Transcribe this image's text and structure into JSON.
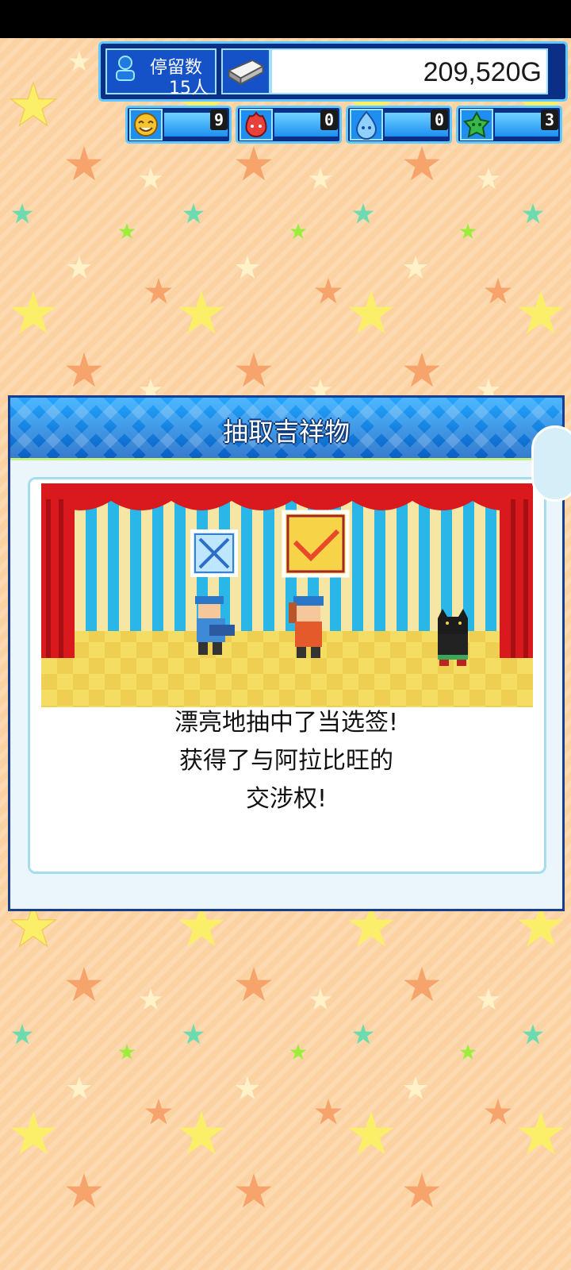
{
  "hud": {
    "stay_label": "停留数",
    "stay_value": "15人",
    "money": "209,520G",
    "resources": [
      {
        "icon": "yellow-smile-icon",
        "value": "9",
        "color": "#f6c431"
      },
      {
        "icon": "red-flame-icon",
        "value": "0",
        "color": "#e8413c"
      },
      {
        "icon": "blue-drop-icon",
        "value": "0",
        "color": "#49a7ec"
      },
      {
        "icon": "green-leaf-icon",
        "value": "3",
        "color": "#38b84a"
      }
    ]
  },
  "dialog": {
    "title": "抽取吉祥物",
    "lines": [
      "漂亮地抽中了当选签!",
      "获得了与阿拉比旺的",
      "交涉权!"
    ]
  },
  "colors": {
    "background": "#fbd3a3",
    "curtain": "#d9191d",
    "header_blue": "#0a7ee8",
    "check_red": "#e64a2a"
  }
}
